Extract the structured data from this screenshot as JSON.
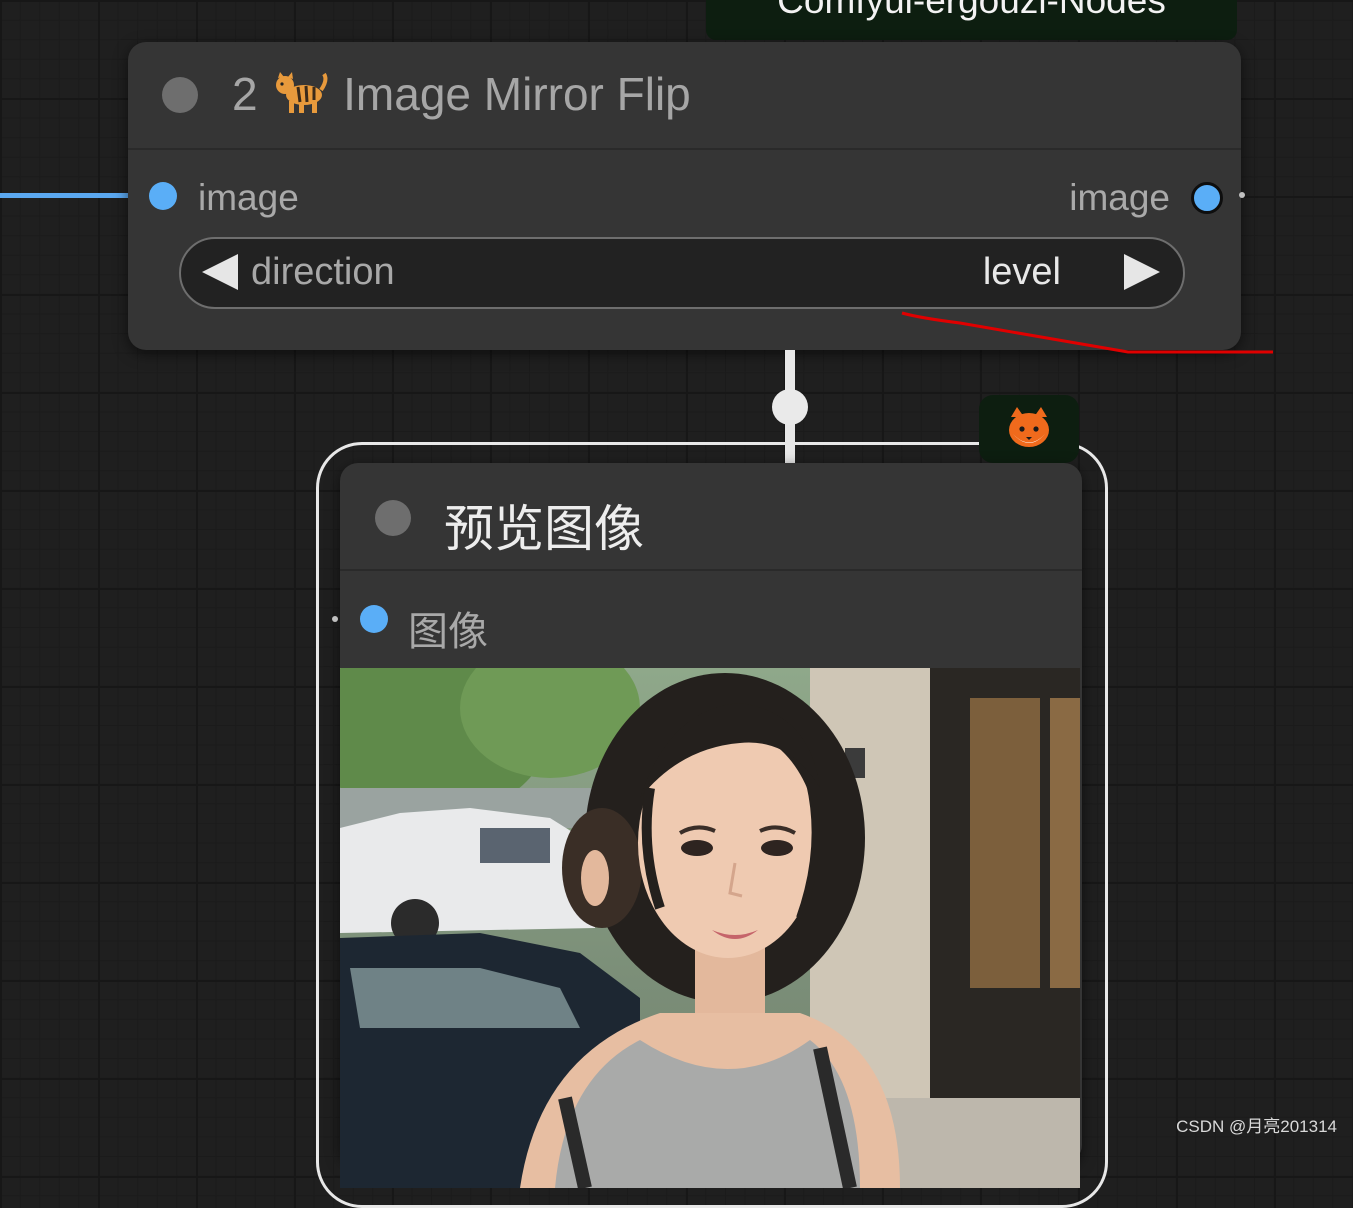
{
  "group": {
    "title": "Comfyui-ergouzi-Nodes"
  },
  "mirror_node": {
    "id": "2",
    "title": "Image Mirror Flip",
    "input_label": "image",
    "output_label": "image",
    "widget": {
      "name": "direction",
      "value": "level"
    }
  },
  "preview_node": {
    "title": "预览图像",
    "input_label": "图像"
  },
  "watermark": "CSDN @月亮201314",
  "colors": {
    "canvas": "#1f1f1f",
    "node_body": "#353535",
    "image_slot": "#5aaef7",
    "group_header": "#0d1e10",
    "annotation": "#e00000"
  },
  "icons": {
    "title_icon": "tiger-icon",
    "badge_icon": "fox-face-icon",
    "left": "triangle-left-icon",
    "right": "triangle-right-icon"
  }
}
